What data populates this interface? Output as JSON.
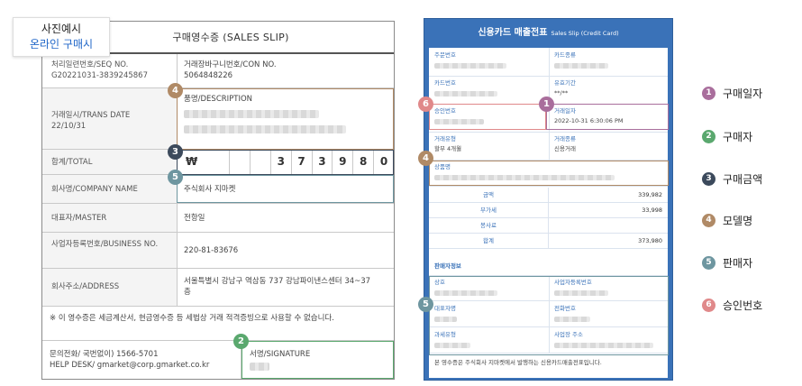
{
  "sample_tag": {
    "line1": "사진예시",
    "line2": "온라인 구매시"
  },
  "receipt": {
    "title": "구매영수증 (SALES SLIP)",
    "seq_label": "처리일련번호/SEQ NO.",
    "seq_value": "G20221031-3839245867",
    "con_label": "거래장바구니번호/CON NO.",
    "con_value": "5064848226",
    "description_label": "품명/DESCRIPTION",
    "trans_date_label": "거래일시/TRANS DATE",
    "trans_date_value": "22/10/31",
    "total_label": "합계/TOTAL",
    "currency_symbol": "₩",
    "amount_digits": [
      "",
      "",
      "3",
      "7",
      "3",
      "9",
      "8",
      "0"
    ],
    "company_label": "회사명/COMPANY NAME",
    "company_value": "주식회사 지마켓",
    "master_label": "대표자/MASTER",
    "master_value": "전항일",
    "business_no_label": "사업자등록번호/BUSINESS NO.",
    "business_no_value": "220-81-83676",
    "address_label": "회사주소/ADDRESS",
    "address_value": "서울특별시 강남구 역삼동 737 강남파이낸스센터 34~37층",
    "notice": "※ 이 영수증은 세금계산서, 현금영수증 등 세법상 거래 적격증빙으로 사용할 수 없습니다.",
    "helpdesk_line1": "문의전화/ 국번없이) 1566-5701",
    "helpdesk_line2": "HELP DESK/ gmarket@corp.gmarket.co.kr",
    "signature_label": "서명/SIGNATURE"
  },
  "card_slip": {
    "title": "신용카드 매출전표",
    "title_en": "Sales Slip (Credit Card)",
    "member_no_label": "주문번호",
    "card_type_label": "카드종류",
    "card_no_label": "카드번호",
    "expiry_label": "유효기간",
    "expiry_value": "**/**",
    "approval_no_label": "승인번호",
    "trans_date_label": "거래일자",
    "trans_date_value": "2022-10-31 6:30:06 PM",
    "trans_type_label": "거래유형",
    "trans_type_value": "할부 4개월",
    "trans_kind_label": "거래종류",
    "trans_kind_value": "신용거래",
    "product_label": "상품명",
    "sum_rows": [
      {
        "label": "금액",
        "value": "339,982"
      },
      {
        "label": "부가세",
        "value": "33,998"
      },
      {
        "label": "봉사료",
        "value": ""
      },
      {
        "label": "합계",
        "value": "373,980"
      }
    ],
    "seller_section_title": "판매자정보",
    "seller_name_label": "상호",
    "seller_bizno_label": "사업자등록번호",
    "seller_ceo_label": "대표자명",
    "seller_phone_label": "전화번호",
    "seller_type_label": "과세유형",
    "seller_address_label": "사업장 주소",
    "footer_note": "본 영수증은 주식회사 지마켓에서 발행하는 신용카드매출전표입니다."
  },
  "legend": [
    {
      "num": "1",
      "label": "구매일자",
      "color": "#a96e9c"
    },
    {
      "num": "2",
      "label": "구매자",
      "color": "#5aa86e"
    },
    {
      "num": "3",
      "label": "구매금액",
      "color": "#3c4a5c"
    },
    {
      "num": "4",
      "label": "모델명",
      "color": "#b08a66"
    },
    {
      "num": "5",
      "label": "판매자",
      "color": "#6e96a0"
    },
    {
      "num": "6",
      "label": "승인번호",
      "color": "#e0898a"
    }
  ]
}
